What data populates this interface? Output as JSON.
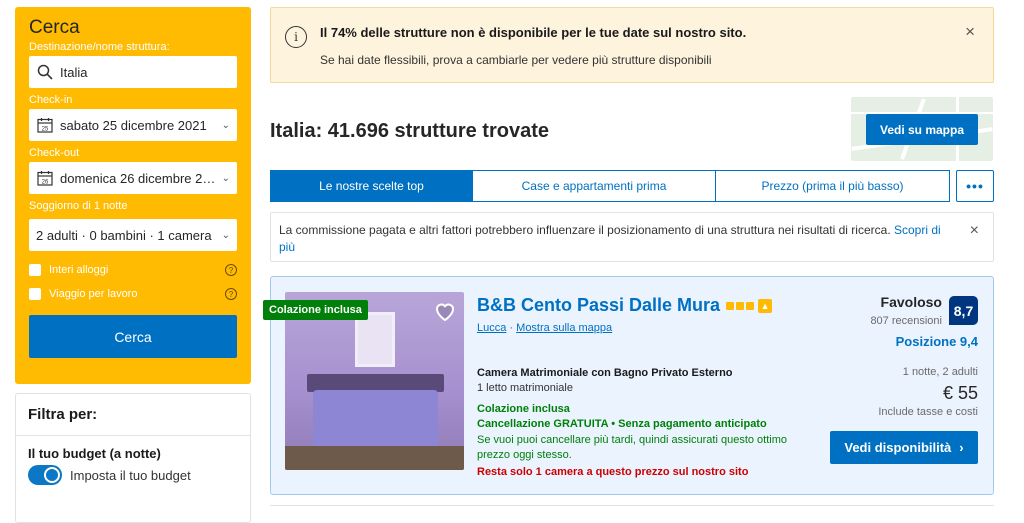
{
  "search": {
    "title": "Cerca",
    "destination_label": "Destinazione/nome struttura:",
    "destination_value": "Italia",
    "checkin_label": "Check-in",
    "checkin_value": "sabato 25 dicembre 2021",
    "checkin_day": "25",
    "checkout_label": "Check-out",
    "checkout_value": "domenica 26 dicembre 20...",
    "checkout_day": "26",
    "stay_label": "Soggiorno di 1 notte",
    "guests_value": "2 adulti · 0 bambini · 1 camera",
    "whole_homes_label": "Interi alloggi",
    "business_label": "Viaggio per lavoro",
    "help_glyph": "?",
    "submit_label": "Cerca"
  },
  "filter": {
    "title": "Filtra per:",
    "budget_title": "Il tuo budget (a notte)",
    "budget_toggle_label": "Imposta il tuo budget"
  },
  "alert": {
    "info_glyph": "i",
    "title": "Il 74% delle strutture non è disponibile per le tue date sul nostro sito.",
    "subtitle": "Se hai date flessibili, prova a cambiarle per vedere più strutture disponibili",
    "close_glyph": "×"
  },
  "results": {
    "title": "Italia: 41.696 strutture trovate",
    "map_button": "Vedi su mappa"
  },
  "tabs": [
    {
      "label": "Le nostre scelte top"
    },
    {
      "label": "Case e appartamenti prima"
    },
    {
      "label": "Prezzo (prima il più basso)"
    },
    {
      "label": "•••"
    }
  ],
  "note": {
    "text": "La commissione pagata e altri fattori potrebbero influenzare il posizionamento di una struttura nei risultati di ricerca. ",
    "link": "Scopri di più",
    "close_glyph": "×"
  },
  "property": {
    "badge": "Colazione inclusa",
    "name": "B&B Cento Passi Dalle Mura",
    "stars": 3,
    "city": "Lucca",
    "separator": "·",
    "map_link": "Mostra sulla mappa",
    "room_name": "Camera Matrimoniale con Bagno Privato Esterno",
    "bed": "1 letto matrimoniale",
    "breakfast": "Colazione inclusa",
    "cancellation": "Cancellazione GRATUITA • Senza pagamento anticipato",
    "cancellation_note": "Se vuoi puoi cancellare più tardi, quindi assicurati questo ottimo prezzo oggi stesso.",
    "scarcity": "Resta solo 1 camera a questo prezzo sul nostro sito",
    "rating_word": "Favoloso",
    "reviews": "807 recensioni",
    "score": "8,7",
    "location_score": "Posizione 9,4",
    "stay": "1 notte, 2 adulti",
    "price": "€ 55",
    "taxes": "Include tasse e costi",
    "cta": "Vedi disponibilità",
    "cta_arrow": "›"
  },
  "colors": {
    "brand_yellow": "#febb02",
    "brand_blue": "#0071c2",
    "dark_blue": "#003580",
    "green": "#008009",
    "red": "#cc0000"
  }
}
